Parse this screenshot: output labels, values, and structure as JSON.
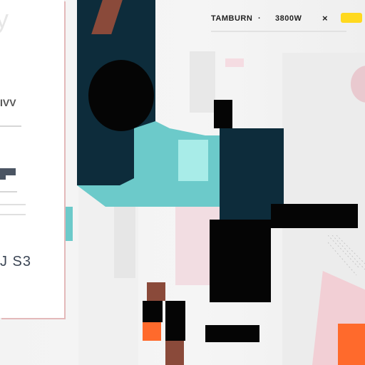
{
  "card": {
    "title": "y",
    "mark": "IVV",
    "value": "J S3"
  },
  "topbar": {
    "label": "TAMBURN",
    "value": "3800W",
    "close_icon": "×"
  },
  "colors": {
    "navy": "#0d2c3b",
    "teal": "#6ccaca",
    "black": "#050505",
    "orange": "#ff6a2c",
    "pink": "#f4d3d8",
    "yellow": "#ffd91f"
  }
}
